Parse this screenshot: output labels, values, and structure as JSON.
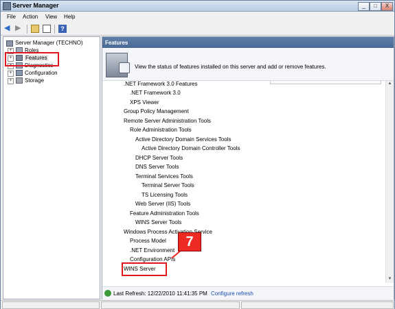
{
  "window": {
    "title": "Server Manager"
  },
  "titlebar_buttons": {
    "minimize": "_",
    "maximize": "□",
    "close": "X"
  },
  "menu": [
    "File",
    "Action",
    "View",
    "Help"
  ],
  "tree": {
    "root": "Server Manager (TECHNO)",
    "items": [
      "Roles",
      "Features",
      "Diagnostics",
      "Configuration",
      "Storage"
    ]
  },
  "panel": {
    "header": "Features",
    "banner_text": "View the status of features installed on this server and add or remove features."
  },
  "features": [
    ".NET Framework 3.0 Features",
    ".NET Framework 3.0",
    "XPS Viewer",
    "Group Policy Management",
    "Remote Server Administration Tools",
    "Role Administration Tools",
    "Active Directory Domain Services Tools",
    "Active Directory Domain Controller Tools",
    "DHCP Server Tools",
    "DNS Server Tools",
    "Terminal Services Tools",
    "Terminal Server Tools",
    "TS Licensing Tools",
    "Web Server (IIS) Tools",
    "Feature Administration Tools",
    "WINS Server Tools",
    "Windows Process Activation Service",
    "Process Model",
    ".NET Environment",
    "Configuration APIs",
    "WINS Server"
  ],
  "footer": {
    "last_refresh": "Last Refresh: 12/22/2010 11:41:35 PM",
    "configure_refresh": "Configure refresh"
  },
  "callout": {
    "number": "7"
  },
  "colors": {
    "highlight": "#e0141a",
    "callout": "#ee2a24",
    "header": "#4a6a95"
  }
}
